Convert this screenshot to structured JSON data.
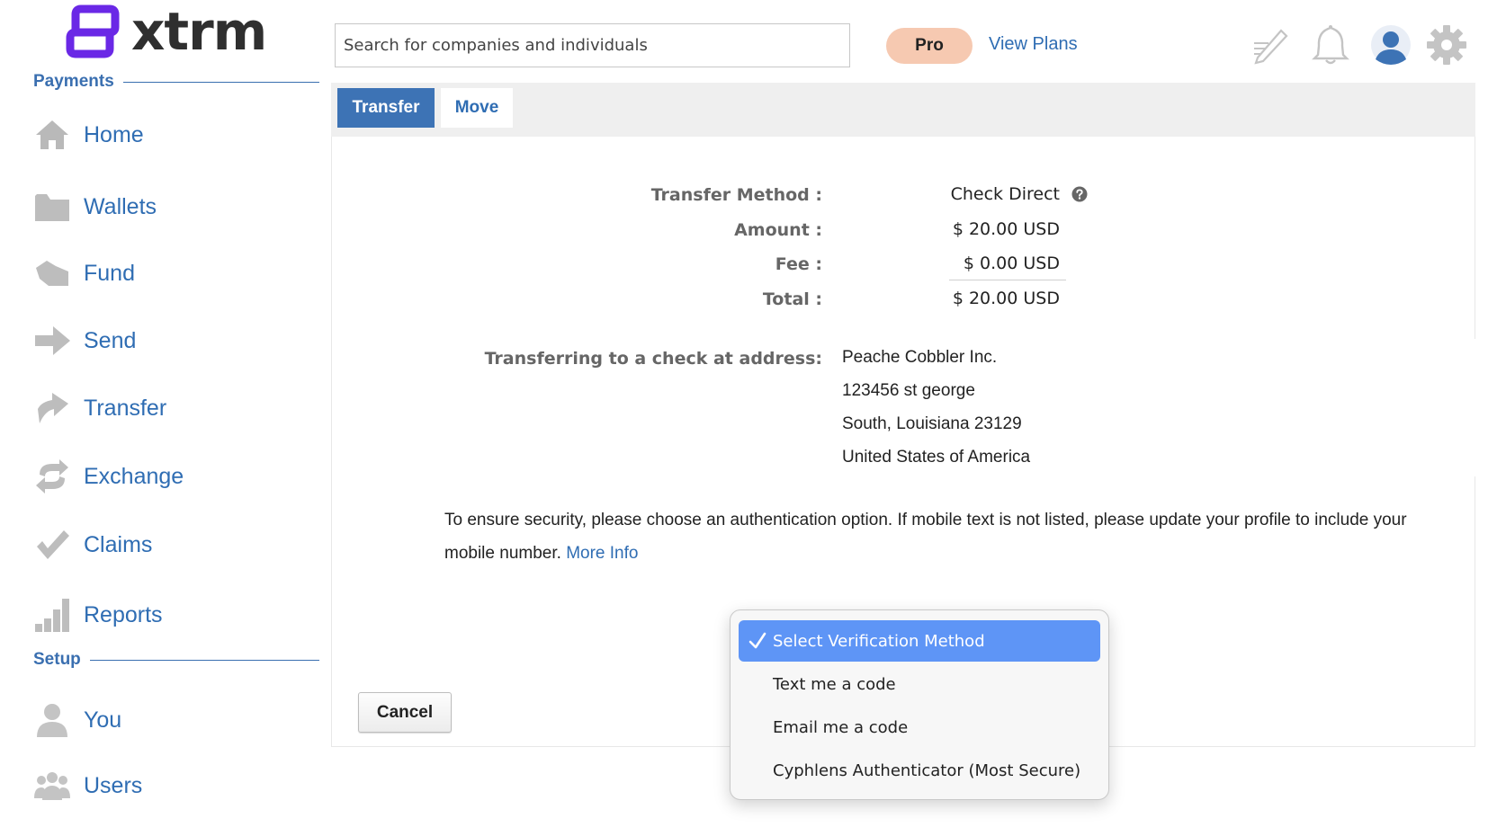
{
  "brand": {
    "name": "xtrm",
    "accent": "#6a28e6"
  },
  "sidebar": {
    "payments_heading": "Payments",
    "setup_heading": "Setup",
    "items": [
      {
        "label": "Home",
        "icon": "home-icon"
      },
      {
        "label": "Wallets",
        "icon": "folder-icon"
      },
      {
        "label": "Fund",
        "icon": "fund-icon"
      },
      {
        "label": "Send",
        "icon": "arrow-right-icon"
      },
      {
        "label": "Transfer",
        "icon": "arrow-up-right-icon"
      },
      {
        "label": "Exchange",
        "icon": "exchange-icon"
      },
      {
        "label": "Claims",
        "icon": "checkmark-icon"
      },
      {
        "label": "Reports",
        "icon": "bar-chart-icon"
      }
    ],
    "setup_items": [
      {
        "label": "You",
        "icon": "person-icon"
      },
      {
        "label": "Users",
        "icon": "users-icon"
      }
    ]
  },
  "header": {
    "search_placeholder": "Search for companies and individuals",
    "plan_badge": "Pro",
    "view_plans": "View Plans",
    "icons": [
      "sign-pen-icon",
      "bell-icon",
      "user-avatar-icon",
      "gear-icon"
    ]
  },
  "tabs": [
    {
      "label": "Transfer",
      "active": true
    },
    {
      "label": "Move",
      "active": false
    }
  ],
  "summary": {
    "method_label": "Transfer Method :",
    "method_value": "Check Direct",
    "amount_label": "Amount :",
    "amount_value": "$ 20.00 USD",
    "fee_label": "Fee :",
    "fee_value": "$ 0.00 USD",
    "total_label": "Total :",
    "total_value": "$ 20.00 USD"
  },
  "address": {
    "label": "Transferring to a check at address:",
    "lines": [
      "Peache Cobbler Inc.",
      "123456 st george",
      "South, Louisiana 23129",
      "United States of America"
    ]
  },
  "notice": {
    "text": "To ensure security, please choose an authentication option. If mobile text is not listed, please update your profile to include your mobile number.",
    "link": "More Info"
  },
  "actions": {
    "cancel": "Cancel"
  },
  "verification_dropdown": {
    "options": [
      {
        "label": "Select Verification Method",
        "selected": true
      },
      {
        "label": "Text me a code",
        "selected": false
      },
      {
        "label": "Email me a code",
        "selected": false
      },
      {
        "label": "Cyphlens Authenticator (Most Secure)",
        "selected": false
      }
    ],
    "selected_color": "#5e95f6"
  }
}
